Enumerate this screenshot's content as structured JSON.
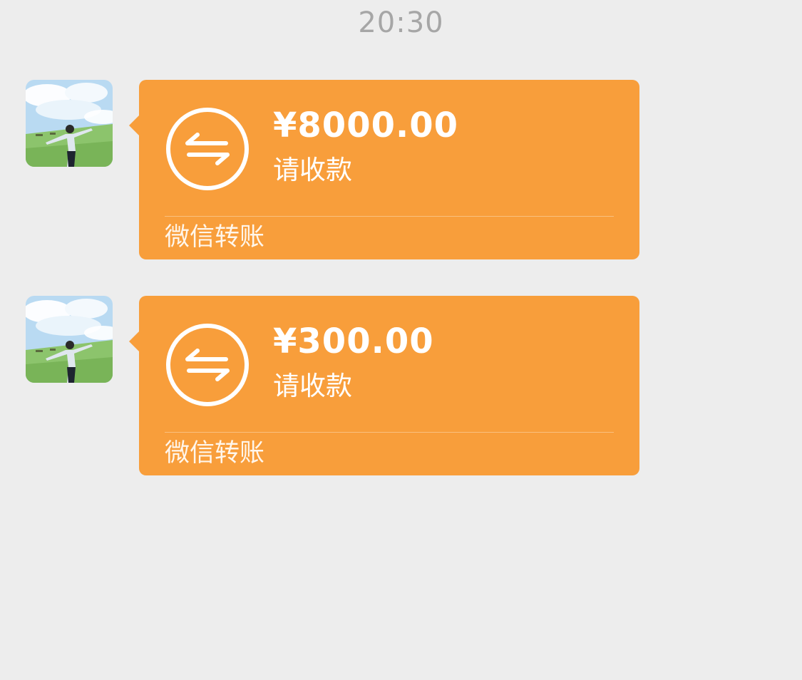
{
  "chat": {
    "timestamp": "20:30",
    "messages": [
      {
        "amount": "¥8000.00",
        "status": "请收款",
        "footer": "微信转账"
      },
      {
        "amount": "¥300.00",
        "status": "请收款",
        "footer": "微信转账"
      }
    ]
  },
  "colors": {
    "background": "#ededed",
    "bubble": "#f89e3b",
    "timestamp_text": "#a6a6a6",
    "bubble_text": "#ffffff"
  },
  "icons": {
    "transfer": "transfer-arrows-icon",
    "avatar": "user-avatar-photo"
  }
}
